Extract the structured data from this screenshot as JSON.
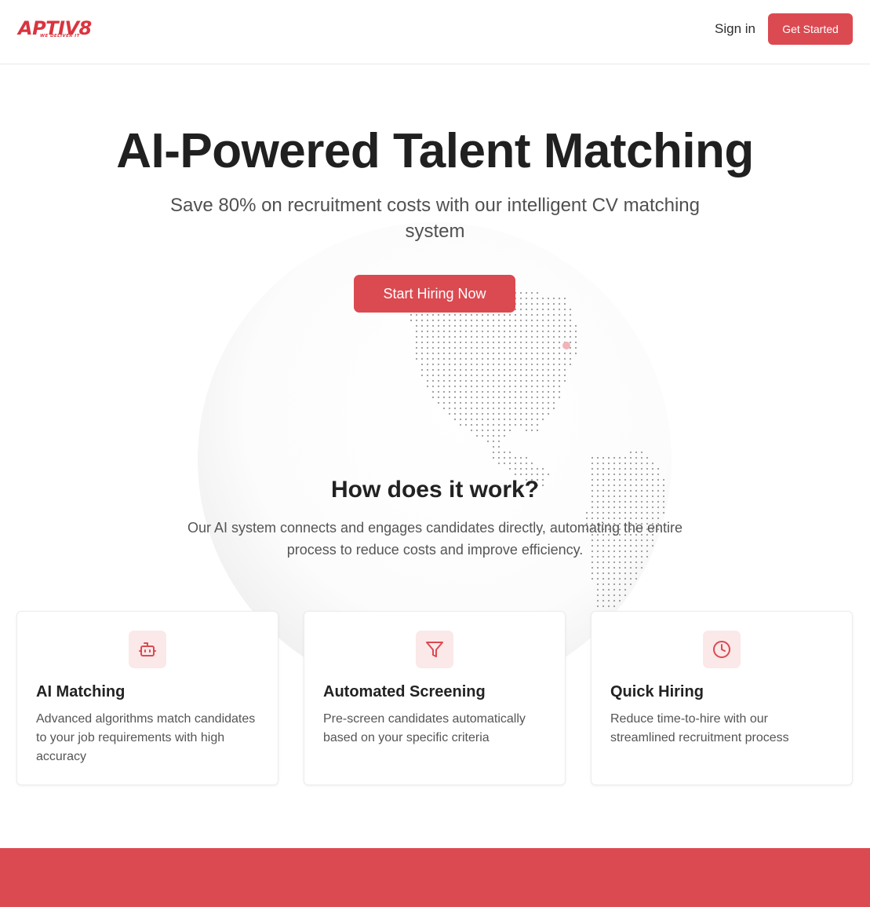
{
  "header": {
    "logo_text": "APTIV8",
    "logo_tagline": "WE DELIVER IT",
    "signin_label": "Sign in",
    "get_started_label": "Get Started"
  },
  "hero": {
    "title": "AI-Powered Talent Matching",
    "subtitle": "Save 80% on recruitment costs with our intelligent CV matching system",
    "cta_label": "Start Hiring Now"
  },
  "how": {
    "title": "How does it work?",
    "description": "Our AI system connects and engages candidates directly, automating the entire process to reduce costs and improve efficiency."
  },
  "features": [
    {
      "icon": "bot-icon",
      "title": "AI Matching",
      "description": "Advanced algorithms match candidates to your job requirements with high accuracy"
    },
    {
      "icon": "filter-icon",
      "title": "Automated Screening",
      "description": "Pre-screen candidates automatically based on your specific criteria"
    },
    {
      "icon": "clock-icon",
      "title": "Quick Hiring",
      "description": "Reduce time-to-hire with our streamlined recruitment process"
    }
  ],
  "colors": {
    "accent": "#db4a51",
    "icon_bg": "#fbe8e9",
    "heading": "#222222",
    "body_text": "#555555"
  }
}
